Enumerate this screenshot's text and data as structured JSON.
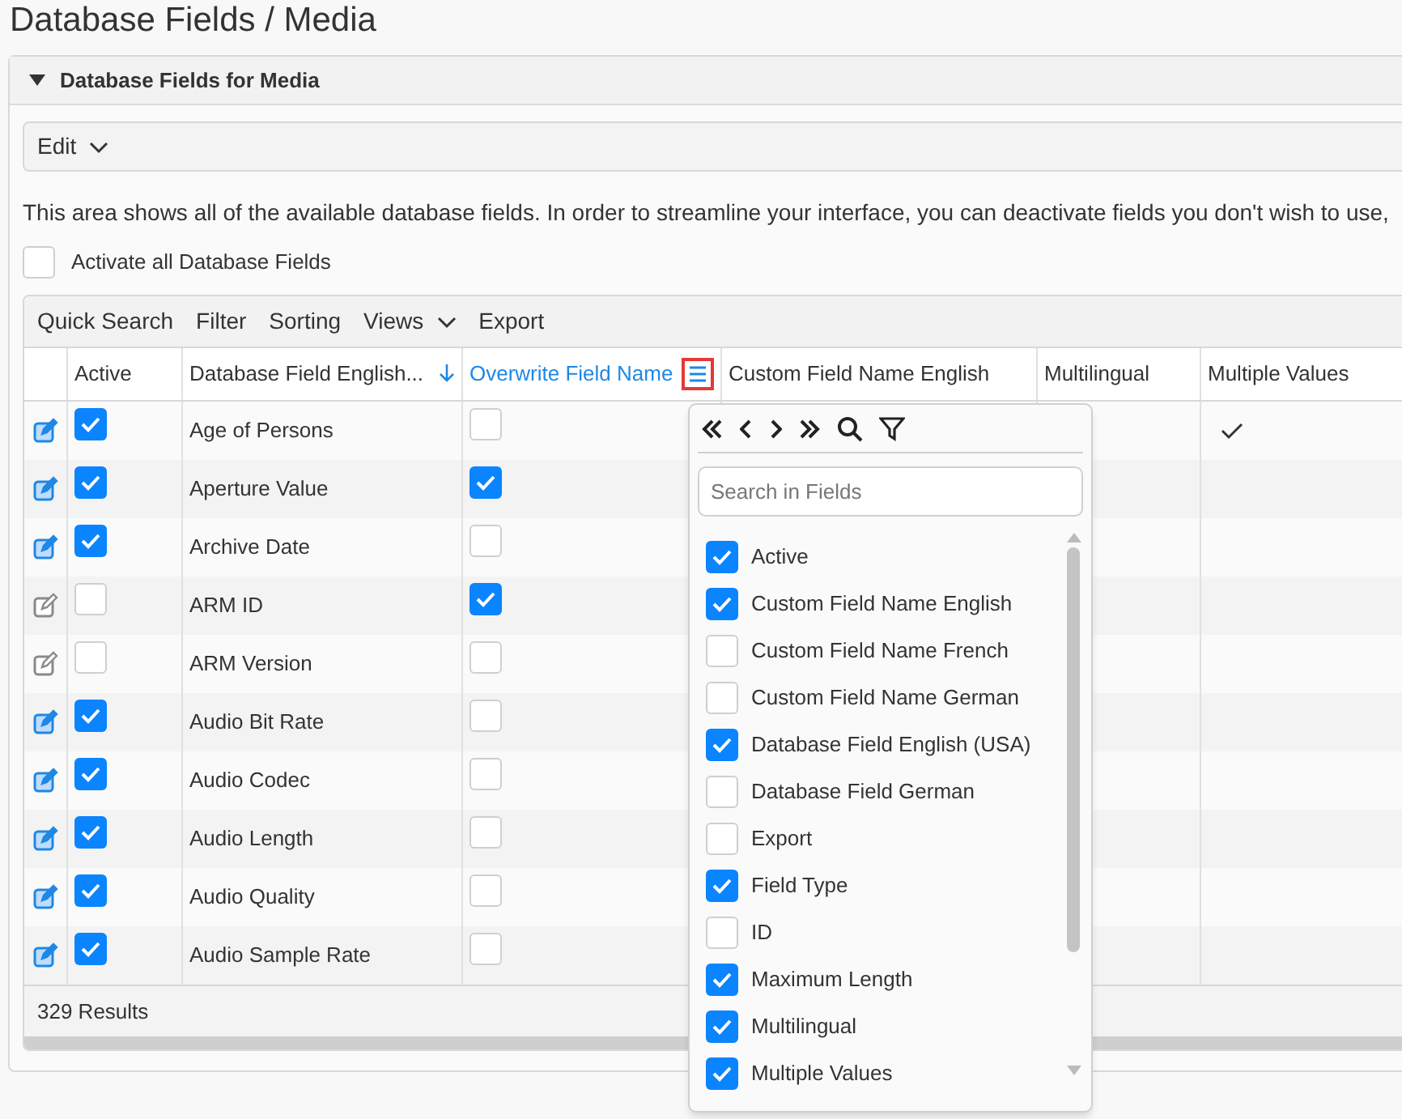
{
  "page_title": "Database Fields / Media",
  "panel": {
    "title": "Database Fields for Media",
    "expanded": true
  },
  "edit_menu": {
    "label": "Edit"
  },
  "description": "This area shows all of the available database fields. In order to streamline your interface, you can deactivate fields you don't wish to use,",
  "activate_all": {
    "label": "Activate all Database Fields",
    "checked": false
  },
  "toolbar": [
    {
      "label": "Quick Search",
      "dropdown": false
    },
    {
      "label": "Filter",
      "dropdown": false
    },
    {
      "label": "Sorting",
      "dropdown": false
    },
    {
      "label": "Views",
      "dropdown": true
    },
    {
      "label": "Export",
      "dropdown": false
    }
  ],
  "columns": [
    {
      "label": "Active",
      "sorted": false,
      "menu_open": false
    },
    {
      "label": "Database Field English...",
      "sorted": true,
      "menu_open": false
    },
    {
      "label": "Overwrite Field Name",
      "sorted": false,
      "menu_open": true
    },
    {
      "label": "Custom Field Name English",
      "sorted": false,
      "menu_open": false
    },
    {
      "label": "Multilingual",
      "sorted": false,
      "menu_open": false
    },
    {
      "label": "Multiple Values",
      "sorted": false,
      "menu_open": false
    }
  ],
  "rows": [
    {
      "active": true,
      "name": "Age of Persons",
      "overwrite": false,
      "multiple_values": true
    },
    {
      "active": true,
      "name": "Aperture Value",
      "overwrite": true,
      "multiple_values": false
    },
    {
      "active": true,
      "name": "Archive Date",
      "overwrite": false,
      "multiple_values": false
    },
    {
      "active": false,
      "name": "ARM ID",
      "overwrite": true,
      "multiple_values": false
    },
    {
      "active": false,
      "name": "ARM Version",
      "overwrite": false,
      "multiple_values": false
    },
    {
      "active": true,
      "name": "Audio Bit Rate",
      "overwrite": false,
      "multiple_values": false
    },
    {
      "active": true,
      "name": "Audio Codec",
      "overwrite": false,
      "multiple_values": false
    },
    {
      "active": true,
      "name": "Audio Length",
      "overwrite": false,
      "multiple_values": false
    },
    {
      "active": true,
      "name": "Audio Quality",
      "overwrite": false,
      "multiple_values": false
    },
    {
      "active": true,
      "name": "Audio Sample Rate",
      "overwrite": false,
      "multiple_values": false
    }
  ],
  "results": "329 Results",
  "column_menu": {
    "search_placeholder": "Search in Fields",
    "fields": [
      {
        "label": "Active",
        "checked": true
      },
      {
        "label": "Custom Field Name English",
        "checked": true
      },
      {
        "label": "Custom Field Name French",
        "checked": false
      },
      {
        "label": "Custom Field Name German",
        "checked": false
      },
      {
        "label": "Database Field English (USA)",
        "checked": true
      },
      {
        "label": "Database Field German",
        "checked": false
      },
      {
        "label": "Export",
        "checked": false
      },
      {
        "label": "Field Type",
        "checked": true
      },
      {
        "label": "ID",
        "checked": false
      },
      {
        "label": "Maximum Length",
        "checked": true
      },
      {
        "label": "Multilingual",
        "checked": true
      },
      {
        "label": "Multiple Values",
        "checked": true
      }
    ]
  }
}
